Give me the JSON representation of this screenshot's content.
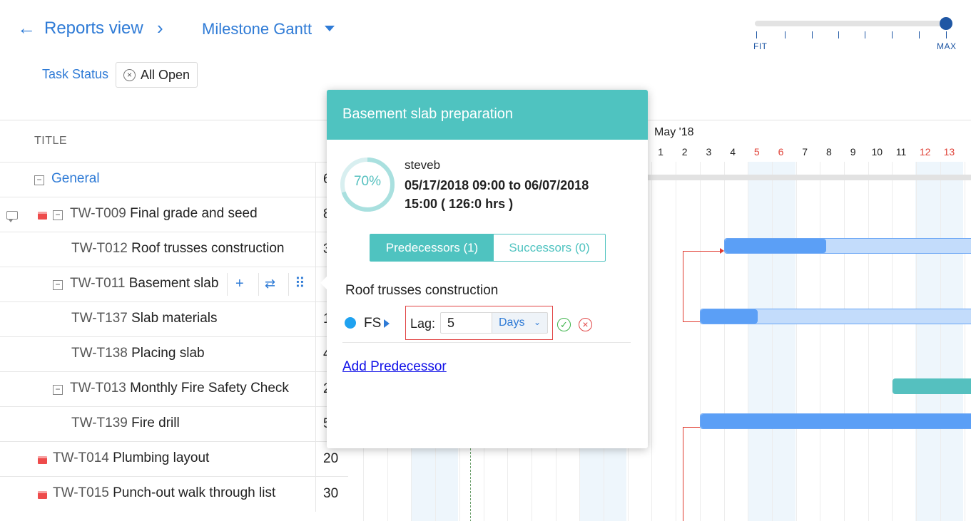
{
  "header": {
    "breadcrumb": "Reports view",
    "view_name": "Milestone Gantt",
    "zoom": {
      "min_label": "FIT",
      "max_label": "MAX",
      "level": 1.0
    }
  },
  "filter": {
    "label": "Task Status",
    "chip": "All Open"
  },
  "table": {
    "column_title": "TITLE",
    "rows": [
      {
        "id": "",
        "name": "General",
        "value": "6"
      },
      {
        "id": "TW-T009",
        "name": "Final grade and seed",
        "value": "8"
      },
      {
        "id": "TW-T012",
        "name": "Roof trusses construction",
        "value": "3"
      },
      {
        "id": "TW-T011",
        "name": "Basement slab",
        "value": ""
      },
      {
        "id": "TW-T137",
        "name": "Slab materials",
        "value": "1"
      },
      {
        "id": "TW-T138",
        "name": "Placing slab",
        "value": "4"
      },
      {
        "id": "TW-T013",
        "name": "Monthly Fire Safety Check",
        "value": "2"
      },
      {
        "id": "TW-T139",
        "name": "Fire drill",
        "value": "5"
      },
      {
        "id": "TW-T014",
        "name": "Plumbing layout",
        "value": "20"
      },
      {
        "id": "TW-T015",
        "name": "Punch-out walk through list",
        "value": "30"
      }
    ],
    "row_actions": {
      "add": "+",
      "reassign": "⇄",
      "drag": "⠿"
    }
  },
  "gantt": {
    "month": "May '18",
    "days": [
      "1",
      "2",
      "3",
      "4",
      "5",
      "6",
      "7",
      "8",
      "9",
      "10",
      "11",
      "12",
      "13",
      "1"
    ],
    "weekend_days": [
      "5",
      "6",
      "12",
      "13"
    ],
    "colors": {
      "bar": "#5b9ff6",
      "bar_light": "#c3dcfb",
      "milestone_bar": "#55c0bf",
      "dependency": "#e03a2e"
    }
  },
  "popup": {
    "title": "Basement slab preparation",
    "progress": "70%",
    "progress_value": 0.7,
    "owner": "steveb",
    "dates": "05/17/2018 09:00 to 06/07/2018 15:00 ( 126:0 hrs )",
    "tab_predecessors": "Predecessors (1)",
    "tab_successors": "Successors (0)",
    "predecessor": {
      "name": "Roof trusses construction",
      "type": "FS",
      "lag_label": "Lag:",
      "lag_value": "5",
      "lag_unit": "Days"
    },
    "add_predecessor": "Add Predecessor"
  }
}
